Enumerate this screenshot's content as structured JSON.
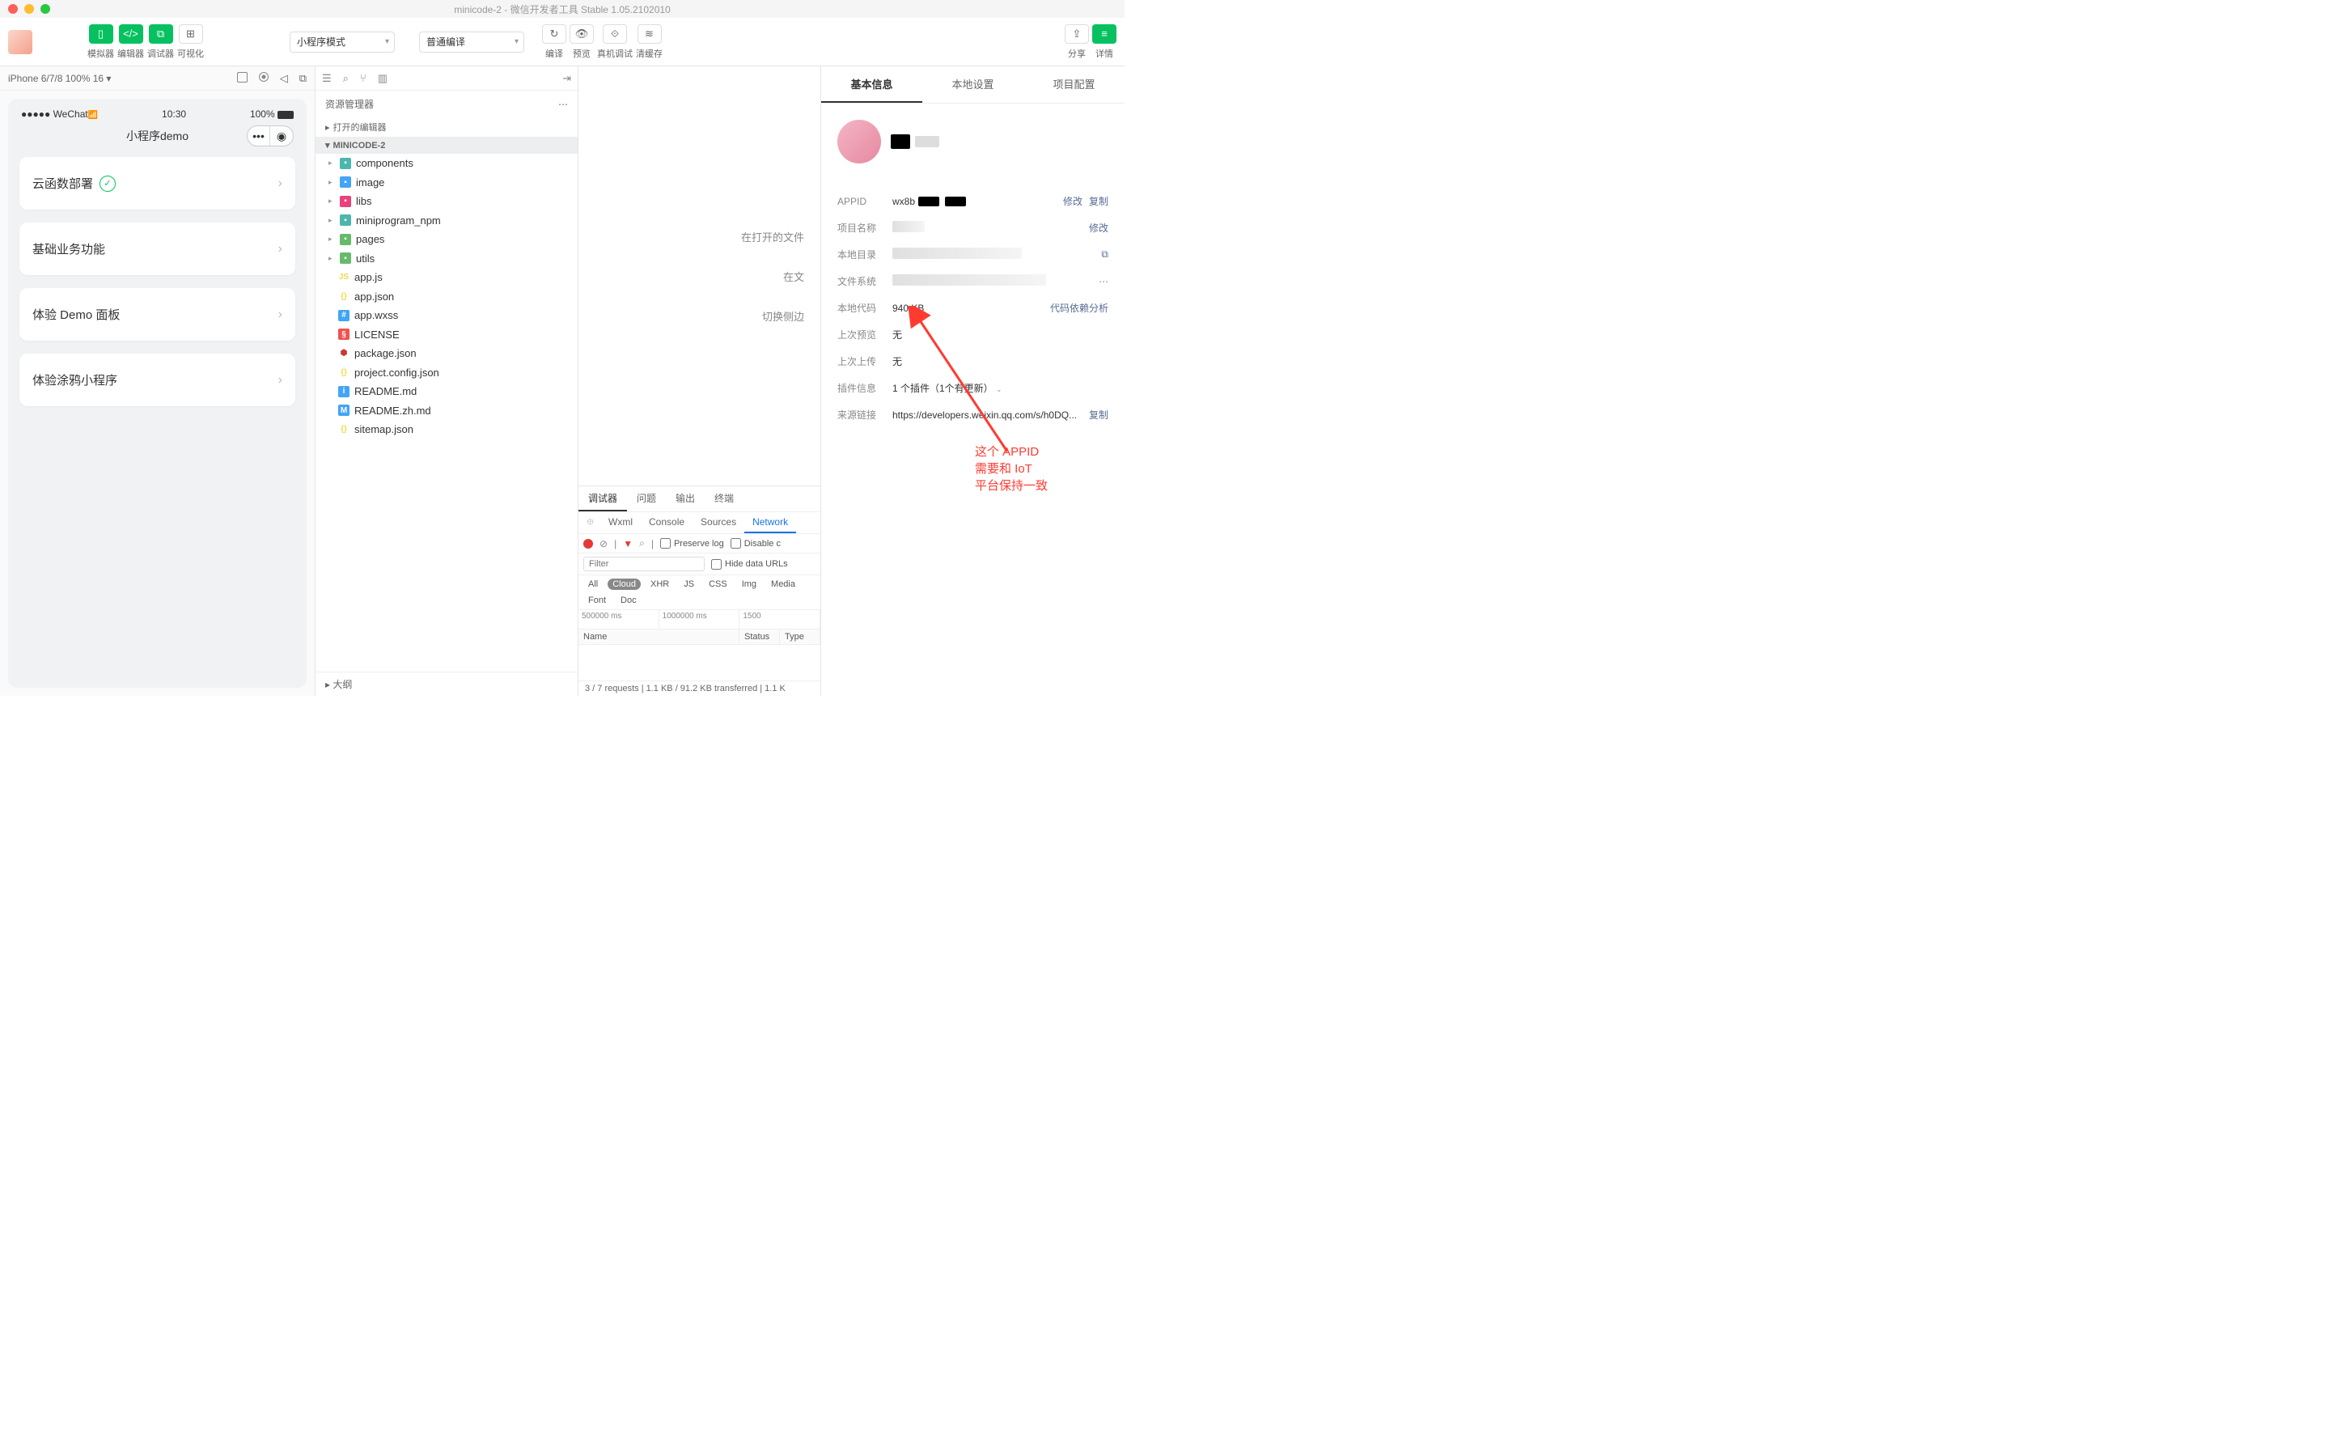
{
  "titlebar": {
    "title": "minicode-2 - 微信开发者工具 Stable 1.05.2102010"
  },
  "toolbar": {
    "simulator": "模拟器",
    "editor": "编辑器",
    "debugger": "调试器",
    "visualize": "可视化",
    "mode_select": "小程序模式",
    "compile_select": "普通编译",
    "compile": "编译",
    "preview": "预览",
    "remote_debug": "真机调试",
    "clear_cache": "清缓存",
    "share": "分享",
    "details": "详情"
  },
  "simulator": {
    "device_info": "iPhone 6/7/8 100% 16 ▾",
    "status_left": "●●●●● WeChat",
    "status_time": "10:30",
    "status_right": "100%",
    "app_title": "小程序demo",
    "cards": [
      {
        "label": "云函数部署",
        "badge": true
      },
      {
        "label": "基础业务功能",
        "badge": false
      },
      {
        "label": "体验 Demo 面板",
        "badge": false
      },
      {
        "label": "体验涂鸦小程序",
        "badge": false
      }
    ]
  },
  "explorer": {
    "title": "资源管理器",
    "open_editors": "打开的编辑器",
    "project": "MINICODE-2",
    "folders": [
      {
        "name": "components",
        "cls": "fi-folder"
      },
      {
        "name": "image",
        "cls": "fi-folder4"
      },
      {
        "name": "libs",
        "cls": "fi-folder3"
      },
      {
        "name": "miniprogram_npm",
        "cls": "fi-folder"
      },
      {
        "name": "pages",
        "cls": "fi-folder2"
      },
      {
        "name": "utils",
        "cls": "fi-folder2"
      }
    ],
    "files": [
      {
        "name": "app.js",
        "cls": "fi-js",
        "icon": "JS"
      },
      {
        "name": "app.json",
        "cls": "fi-json",
        "icon": "{}"
      },
      {
        "name": "app.wxss",
        "cls": "fi-wxss",
        "icon": "#"
      },
      {
        "name": "LICENSE",
        "cls": "fi-lic",
        "icon": "§"
      },
      {
        "name": "package.json",
        "cls": "fi-npm",
        "icon": "⬢"
      },
      {
        "name": "project.config.json",
        "cls": "fi-json",
        "icon": "{}"
      },
      {
        "name": "README.md",
        "cls": "fi-md",
        "icon": "i"
      },
      {
        "name": "README.zh.md",
        "cls": "fi-md",
        "icon": "M"
      },
      {
        "name": "sitemap.json",
        "cls": "fi-json",
        "icon": "{}"
      }
    ],
    "outline": "大纲"
  },
  "center": {
    "hint1": "在打开的文件",
    "hint2": "在文",
    "hint3": "切换侧边"
  },
  "devtools": {
    "tabs": [
      "调试器",
      "问题",
      "输出",
      "终端"
    ],
    "subtabs_pre": "☰",
    "subtabs": [
      "Wxml",
      "Console",
      "Sources",
      "Network"
    ],
    "preserve_log": "Preserve log",
    "disable_cache": "Disable c",
    "filter_placeholder": "Filter",
    "hide_data_urls": "Hide data URLs",
    "types": [
      "All",
      "Cloud",
      "XHR",
      "JS",
      "CSS",
      "Img",
      "Media",
      "Font",
      "Doc"
    ],
    "timeline": [
      "500000 ms",
      "1000000 ms",
      "1500"
    ],
    "headers": [
      "Name",
      "Status",
      "Type"
    ],
    "status_line": "3 / 7 requests   |   1.1 KB / 91.2 KB transferred   |   1.1 K"
  },
  "details": {
    "tabs": [
      "基本信息",
      "本地设置",
      "项目配置"
    ],
    "rows": {
      "appid_label": "APPID",
      "appid_value": "wx8b",
      "appid_modify": "修改",
      "appid_copy": "复制",
      "project_name_label": "项目名称",
      "project_name_modify": "修改",
      "local_dir_label": "本地目录",
      "file_system_label": "文件系统",
      "local_code_label": "本地代码",
      "local_code_value": "940 KB",
      "code_dep": "代码依赖分析",
      "last_preview_label": "上次预览",
      "last_preview_value": "无",
      "last_upload_label": "上次上传",
      "last_upload_value": "无",
      "plugin_label": "插件信息",
      "plugin_value": "1 个插件（1个有更新）",
      "source_label": "来源链接",
      "source_value": "https://developers.weixin.qq.com/s/h0DQ...",
      "source_copy": "复制"
    }
  },
  "annotation": {
    "text": "这个 APPID\n需要和 IoT\n平台保持一致"
  }
}
